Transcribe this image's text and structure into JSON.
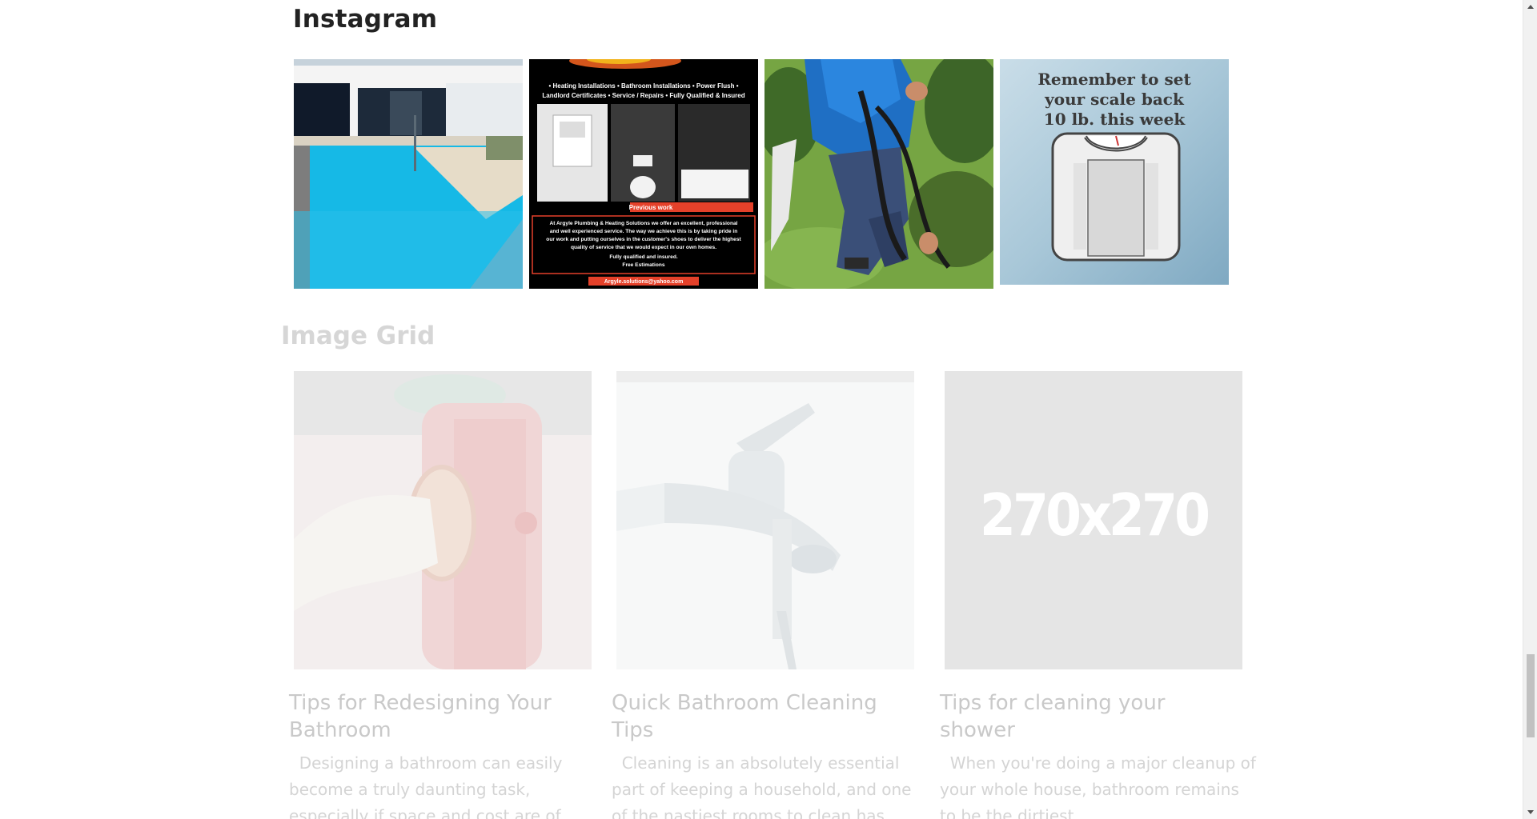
{
  "instagram": {
    "title": "Instagram",
    "tiles": [
      {
        "name": "pool"
      },
      {
        "name": "plumbing-flyer",
        "flyer": {
          "services": "• Heating Installations • Bathroom Installations • Power Flush •",
          "services2": "Landlord Certificates • Service / Repairs • Fully Qualified & Insured",
          "banner": "Previous work",
          "body1": "At Argyle Plumbing & Heating Solutions we offer an excellent, professional",
          "body2": "and well experienced service. The way we achieve this is by taking pride in",
          "body3": "our work and putting ourselves in the customer's shoes to deliver the highest",
          "body4": "quality of service that we would expect in our own homes.",
          "body5": "Fully qualified and insured.",
          "body6": "Free Estimations",
          "email": "Argyle.solutions@yahoo.com"
        }
      },
      {
        "name": "worker-garden"
      },
      {
        "name": "scale-reminder",
        "caption": [
          "Remember to set",
          "your scale back",
          "10 lb. this week"
        ]
      }
    ]
  },
  "image_grid": {
    "title": "Image Grid",
    "cards": [
      {
        "title": "Tips for Redesigning Your Bathroom",
        "text": "  Designing a bathroom can easily become a truly daunting task, especially if space and cost are of"
      },
      {
        "title": "Quick Bathroom Cleaning Tips",
        "text": "  Cleaning is an absolutely essential part of keeping a household, and one of the nastiest rooms to clean has"
      },
      {
        "title": "Tips for cleaning your shower",
        "placeholder": "270x270",
        "text": "  When you're doing a major cleanup of your whole house, bathroom remains to be the dirtiest"
      }
    ]
  }
}
